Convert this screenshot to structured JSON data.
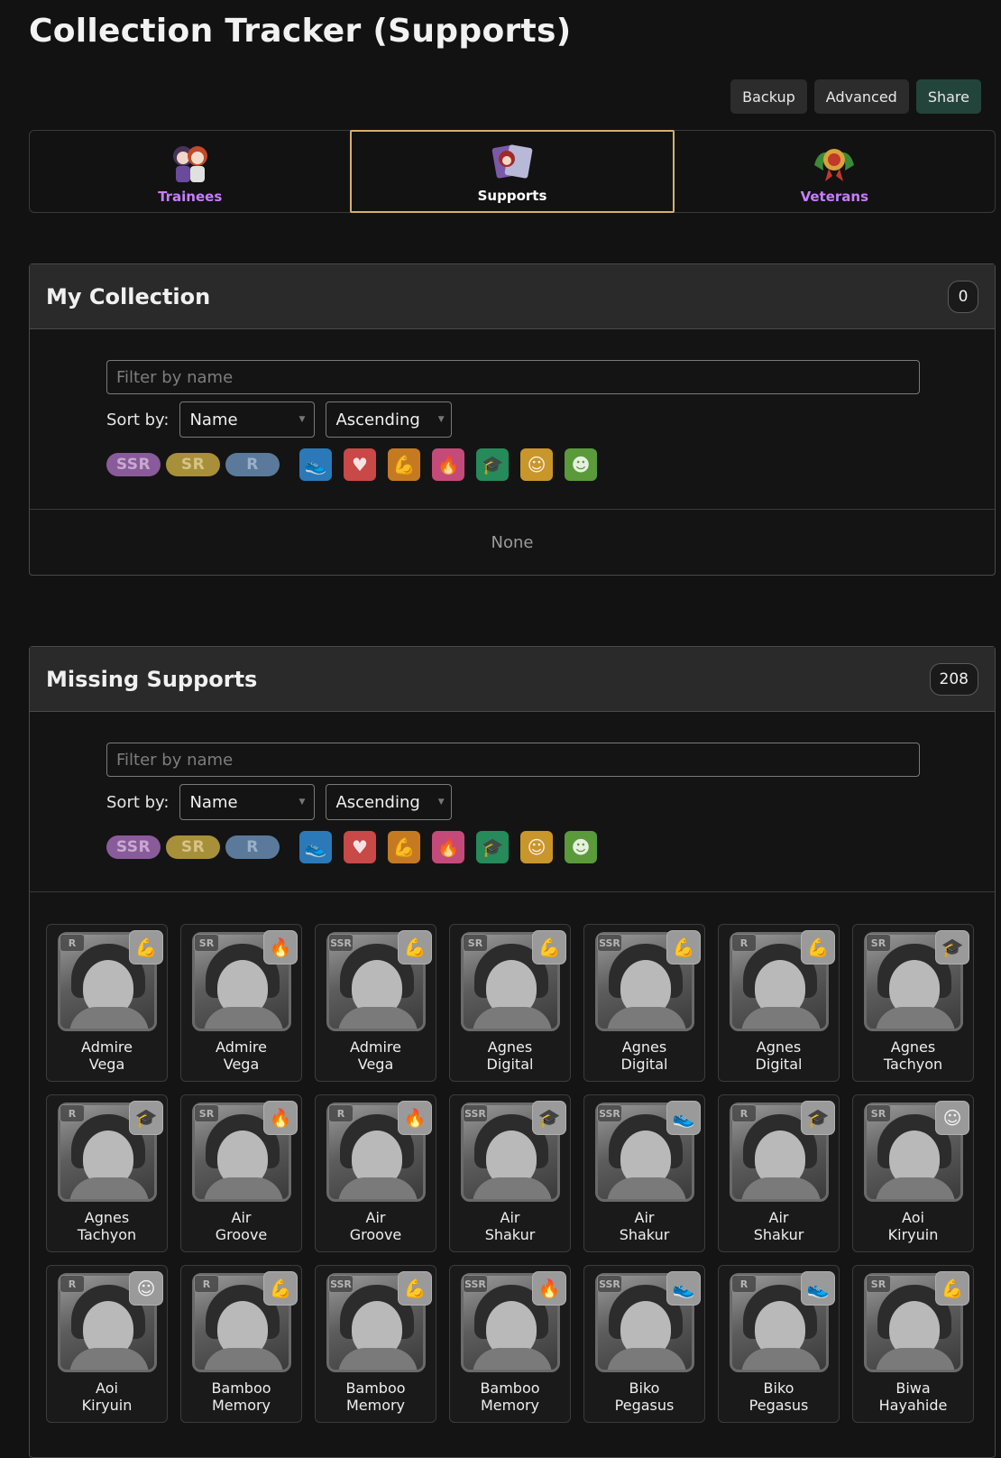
{
  "page": {
    "title": "Collection Tracker (Supports)"
  },
  "actions": {
    "backup": "Backup",
    "advanced": "Advanced",
    "share": "Share"
  },
  "tabs": [
    {
      "label": "Trainees",
      "icon": "trainees-icon",
      "active": false
    },
    {
      "label": "Supports",
      "icon": "supports-icon",
      "active": true
    },
    {
      "label": "Veterans",
      "icon": "veterans-icon",
      "active": false
    }
  ],
  "my_collection": {
    "title": "My Collection",
    "count": "0",
    "filter_placeholder": "Filter by name",
    "sort_label": "Sort by:",
    "sort_field": "Name",
    "sort_order": "Ascending",
    "empty_text": "None"
  },
  "missing": {
    "title": "Missing Supports",
    "count": "208",
    "filter_placeholder": "Filter by name",
    "sort_label": "Sort by:",
    "sort_field": "Name",
    "sort_order": "Ascending"
  },
  "rarity_filters": [
    "SSR",
    "SR",
    "R"
  ],
  "type_filters": [
    "speed-icon",
    "stamina-icon",
    "power-icon",
    "guts-icon",
    "wit-icon",
    "friend-icon",
    "group-icon"
  ],
  "cards": [
    {
      "line1": "Admire",
      "line2": "Vega",
      "rarity": "R",
      "type": "power"
    },
    {
      "line1": "Admire",
      "line2": "Vega",
      "rarity": "SR",
      "type": "guts"
    },
    {
      "line1": "Admire",
      "line2": "Vega",
      "rarity": "SSR",
      "type": "power"
    },
    {
      "line1": "Agnes",
      "line2": "Digital",
      "rarity": "SR",
      "type": "power"
    },
    {
      "line1": "Agnes",
      "line2": "Digital",
      "rarity": "SSR",
      "type": "power"
    },
    {
      "line1": "Agnes",
      "line2": "Digital",
      "rarity": "R",
      "type": "power"
    },
    {
      "line1": "Agnes",
      "line2": "Tachyon",
      "rarity": "SR",
      "type": "wit"
    },
    {
      "line1": "Agnes",
      "line2": "Tachyon",
      "rarity": "R",
      "type": "wit"
    },
    {
      "line1": "Air",
      "line2": "Groove",
      "rarity": "SR",
      "type": "guts"
    },
    {
      "line1": "Air",
      "line2": "Groove",
      "rarity": "R",
      "type": "guts"
    },
    {
      "line1": "Air",
      "line2": "Shakur",
      "rarity": "SSR",
      "type": "wit"
    },
    {
      "line1": "Air",
      "line2": "Shakur",
      "rarity": "SSR",
      "type": "speed"
    },
    {
      "line1": "Air",
      "line2": "Shakur",
      "rarity": "R",
      "type": "wit"
    },
    {
      "line1": "Aoi",
      "line2": "Kiryuin",
      "rarity": "SR",
      "type": "friend"
    },
    {
      "line1": "Aoi",
      "line2": "Kiryuin",
      "rarity": "R",
      "type": "friend"
    },
    {
      "line1": "Bamboo",
      "line2": "Memory",
      "rarity": "R",
      "type": "power"
    },
    {
      "line1": "Bamboo",
      "line2": "Memory",
      "rarity": "SSR",
      "type": "power"
    },
    {
      "line1": "Bamboo",
      "line2": "Memory",
      "rarity": "SSR",
      "type": "guts"
    },
    {
      "line1": "Biko",
      "line2": "Pegasus",
      "rarity": "SSR",
      "type": "speed"
    },
    {
      "line1": "Biko",
      "line2": "Pegasus",
      "rarity": "R",
      "type": "speed"
    },
    {
      "line1": "Biwa",
      "line2": "Hayahide",
      "rarity": "SR",
      "type": "power"
    }
  ]
}
